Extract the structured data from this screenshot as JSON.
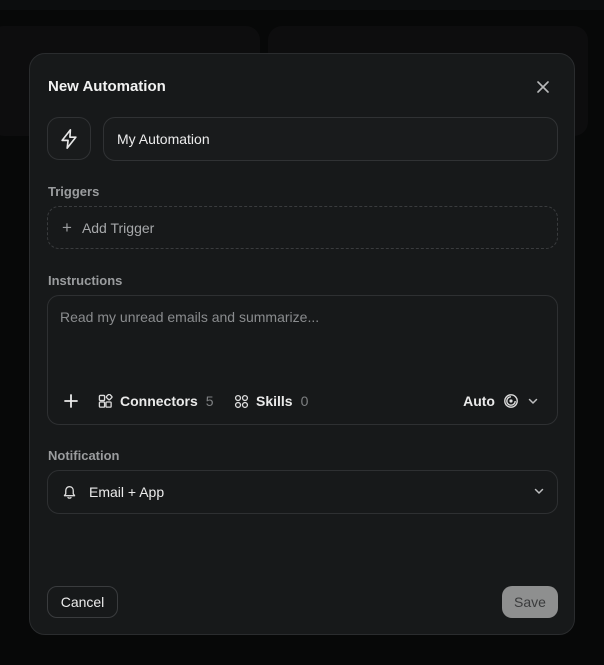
{
  "dialog": {
    "title": "New Automation"
  },
  "name_field": {
    "value": "My Automation"
  },
  "triggers": {
    "label": "Triggers",
    "add_label": "Add Trigger"
  },
  "instructions": {
    "label": "Instructions",
    "placeholder": "Read my unread emails and summarize...",
    "connectors_label": "Connectors",
    "connectors_count": "5",
    "skills_label": "Skills",
    "skills_count": "0",
    "model_label": "Auto"
  },
  "notification": {
    "label": "Notification",
    "selected": "Email + App"
  },
  "footer": {
    "cancel_label": "Cancel",
    "save_label": "Save"
  },
  "colors": {
    "modal_bg": "#17191a",
    "save_bg": "#8e8f8f"
  }
}
